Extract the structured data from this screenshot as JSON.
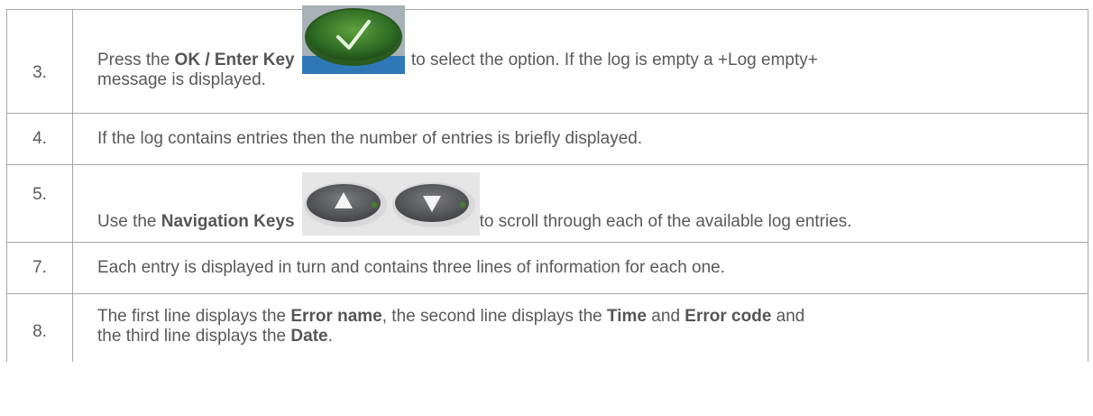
{
  "rows": [
    {
      "number": "3.",
      "pre": "Press the ",
      "bold1": "OK / Enter Key",
      "post": " to select the option. If the log is empty a +Log empty+",
      "line2": "message is displayed.",
      "icon": "ok-enter-key-icon"
    },
    {
      "number": "4.",
      "text": "If the log contains entries then the number of entries is briefly displayed."
    },
    {
      "number": "5.",
      "pre": "Use the ",
      "bold1": "Navigation Keys",
      "post": "to scroll through each of the available log entries.",
      "icon": "up-down-navigation-keys-icon"
    },
    {
      "number": "7.",
      "text": "Each entry is displayed in turn and contains three lines of information for each one."
    },
    {
      "number": "8.",
      "t1": "The first line displays the ",
      "b1": "Error name",
      "t2": ", the second line displays the ",
      "b2": "Time",
      "t3": " and ",
      "b3": "Error code",
      "t4": " and",
      "t5": "the third line displays the ",
      "b4": "Date",
      "t6": "."
    }
  ],
  "colors": {
    "border": "#a6a6a6",
    "text": "#58595b",
    "ok_key_green": "#3d7a2c",
    "nav_key_grey": "#5f6062"
  }
}
